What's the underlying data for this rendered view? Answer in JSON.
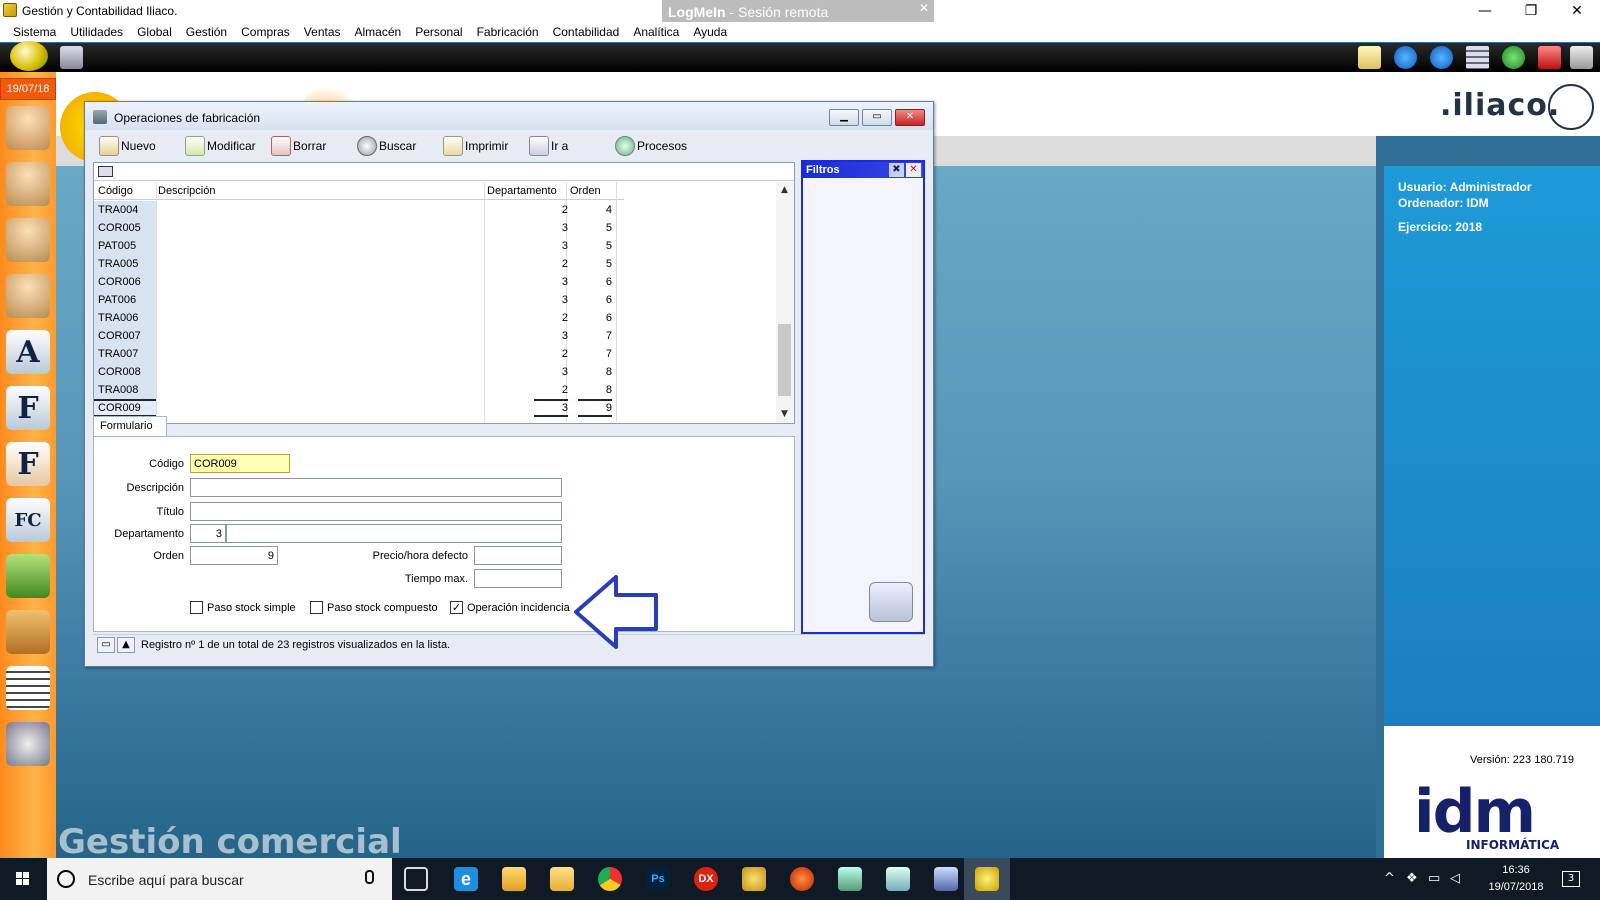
{
  "app": {
    "title": "Gestión y Contabilidad Iliaco.",
    "logmein_brand": "LogMeIn",
    "logmein_sep": " - ",
    "logmein_session": "Sesión remota",
    "window_controls": [
      "—",
      "❐",
      "✕"
    ]
  },
  "menu": [
    "Sistema",
    "Utilidades",
    "Global",
    "Gestión",
    "Compras",
    "Ventas",
    "Almacén",
    "Personal",
    "Fabricación",
    "Contabilidad",
    "Analítica",
    "Ayuda"
  ],
  "sidebar": {
    "date": "19/07/18",
    "icon_letters": [
      "A",
      "F",
      "F",
      "FC"
    ]
  },
  "desktop": {
    "background_label": "Gestión comercial",
    "logo_text": ".iliaco.",
    "info": {
      "usuario": "Usuario: Administrador",
      "ordenador": "Ordenador: IDM",
      "ejercicio": "Ejercicio: 2018"
    },
    "version": "Versión: 223 180.719",
    "idm_logo": "idm",
    "idm_sub": "INFORMÁTICA"
  },
  "dialog": {
    "title": "Operaciones de fabricación",
    "toolbar": [
      "Nuevo",
      "Modificar",
      "Borrar",
      "Buscar",
      "Imprimir",
      "Ir a",
      "Procesos"
    ],
    "grid": {
      "columns": [
        "Código",
        "Descripción",
        "Departamento",
        "Orden"
      ],
      "rows": [
        {
          "codigo": "TRA004",
          "departamento": "2",
          "orden": "4"
        },
        {
          "codigo": "COR005",
          "departamento": "3",
          "orden": "5"
        },
        {
          "codigo": "PAT005",
          "departamento": "3",
          "orden": "5"
        },
        {
          "codigo": "TRA005",
          "departamento": "2",
          "orden": "5"
        },
        {
          "codigo": "COR006",
          "departamento": "3",
          "orden": "6"
        },
        {
          "codigo": "PAT006",
          "departamento": "3",
          "orden": "6"
        },
        {
          "codigo": "TRA006",
          "departamento": "2",
          "orden": "6"
        },
        {
          "codigo": "COR007",
          "departamento": "3",
          "orden": "7"
        },
        {
          "codigo": "TRA007",
          "departamento": "2",
          "orden": "7"
        },
        {
          "codigo": "COR008",
          "departamento": "3",
          "orden": "8"
        },
        {
          "codigo": "TRA008",
          "departamento": "2",
          "orden": "8"
        },
        {
          "codigo": "COR009",
          "departamento": "3",
          "orden": "9"
        }
      ]
    },
    "filtros_title": "Filtros",
    "form": {
      "tab": "Formulario",
      "labels": {
        "codigo": "Código",
        "descripcion": "Descripción",
        "titulo": "Título",
        "departamento": "Departamento",
        "orden": "Orden",
        "precio_hora": "Precio/hora defecto",
        "tiempo_max": "Tiempo max."
      },
      "values": {
        "codigo": "COR009",
        "descripcion": "",
        "titulo": "",
        "departamento": "3",
        "departamento_nombre": "",
        "orden": "9",
        "precio_hora": "",
        "tiempo_max": ""
      },
      "checkboxes": [
        {
          "label": "Paso stock simple",
          "checked": false
        },
        {
          "label": "Paso stock compuesto",
          "checked": false
        },
        {
          "label": "Operación incidencia",
          "checked": true
        }
      ]
    },
    "status": "Registro nº 1 de un total de 23 registros visualizados en la lista."
  },
  "taskbar": {
    "search_placeholder": "Escribe aquí para buscar",
    "time": "16:36",
    "date": "19/07/2018",
    "notification_count": "3",
    "app_labels": {
      "dx": "DX",
      "ps": "Ps"
    }
  }
}
